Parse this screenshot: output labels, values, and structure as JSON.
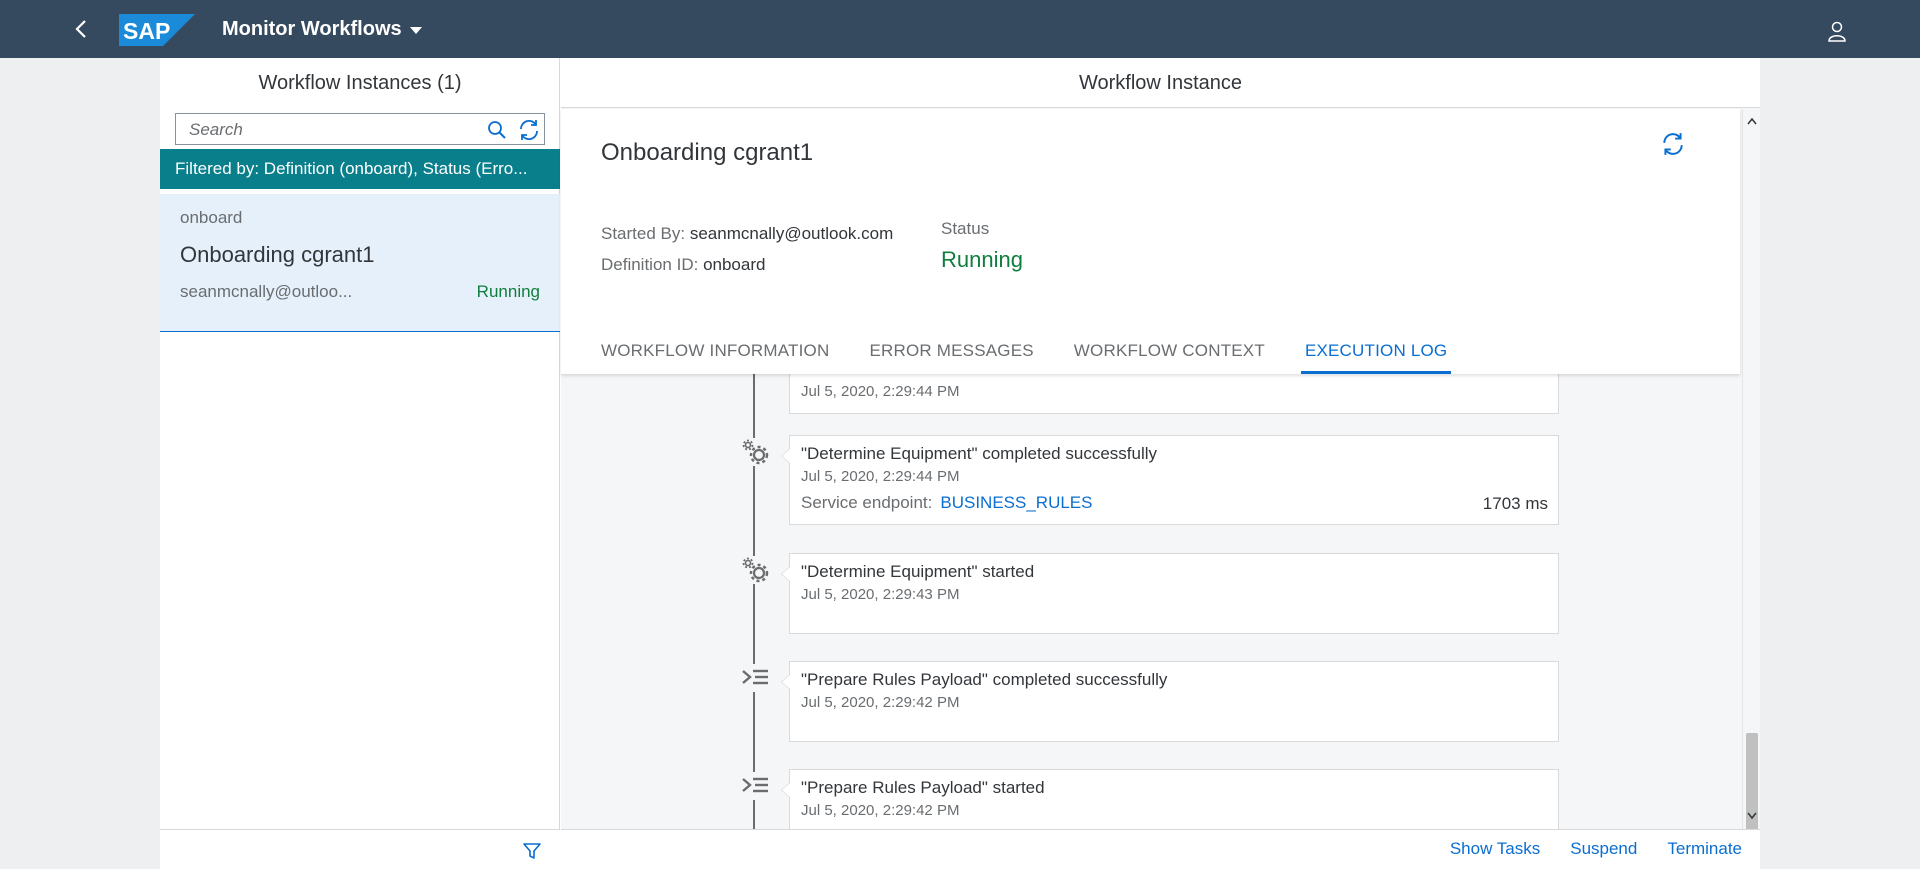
{
  "shell": {
    "logo_text": "SAP",
    "app_title": "Monitor Workflows"
  },
  "master": {
    "title": "Workflow Instances (1)",
    "search_placeholder": "Search",
    "filter_text": "Filtered by: Definition (onboard), Status (Erro...",
    "items": [
      {
        "definition": "onboard",
        "name": "Onboarding cgrant1",
        "started_by": "seanmcnally@outloo...",
        "status": "Running"
      }
    ]
  },
  "detail": {
    "title": "Workflow Instance",
    "instance_title": "Onboarding cgrant1",
    "started_by_label": "Started By:",
    "started_by_value": "seanmcnally@outlook.com",
    "definition_label": "Definition ID:",
    "definition_value": "onboard",
    "status_label": "Status",
    "status_value": "Running",
    "tabs": [
      {
        "label": "WORKFLOW INFORMATION",
        "active": false
      },
      {
        "label": "ERROR MESSAGES",
        "active": false
      },
      {
        "label": "WORKFLOW CONTEXT",
        "active": false
      },
      {
        "label": "EXECUTION LOG",
        "active": true
      }
    ],
    "log": [
      {
        "title": "",
        "date": "Jul 5, 2020, 2:29:44 PM",
        "icon": "none"
      },
      {
        "title": "\"Determine Equipment\" completed successfully",
        "date": "Jul 5, 2020, 2:29:44 PM",
        "endpoint_label": "Service endpoint:",
        "endpoint_value": "BUSINESS_RULES",
        "duration": "1703 ms",
        "icon": "gears-icon"
      },
      {
        "title": "\"Determine Equipment\" started",
        "date": "Jul 5, 2020, 2:29:43 PM",
        "icon": "gears-icon"
      },
      {
        "title": "\"Prepare Rules Payload\" completed successfully",
        "date": "Jul 5, 2020, 2:29:42 PM",
        "icon": "script-task-icon"
      },
      {
        "title": "\"Prepare Rules Payload\" started",
        "date": "Jul 5, 2020, 2:29:42 PM",
        "icon": "script-task-icon"
      }
    ],
    "footer_buttons": {
      "show_tasks": "Show Tasks",
      "suspend": "Suspend",
      "terminate": "Terminate"
    }
  },
  "colors": {
    "shell_bg": "#354a5f",
    "accent": "#0a6ed1",
    "filter_bar": "#0a7f8c",
    "positive": "#107e3e",
    "selected_item_bg": "#e5f0fa"
  }
}
